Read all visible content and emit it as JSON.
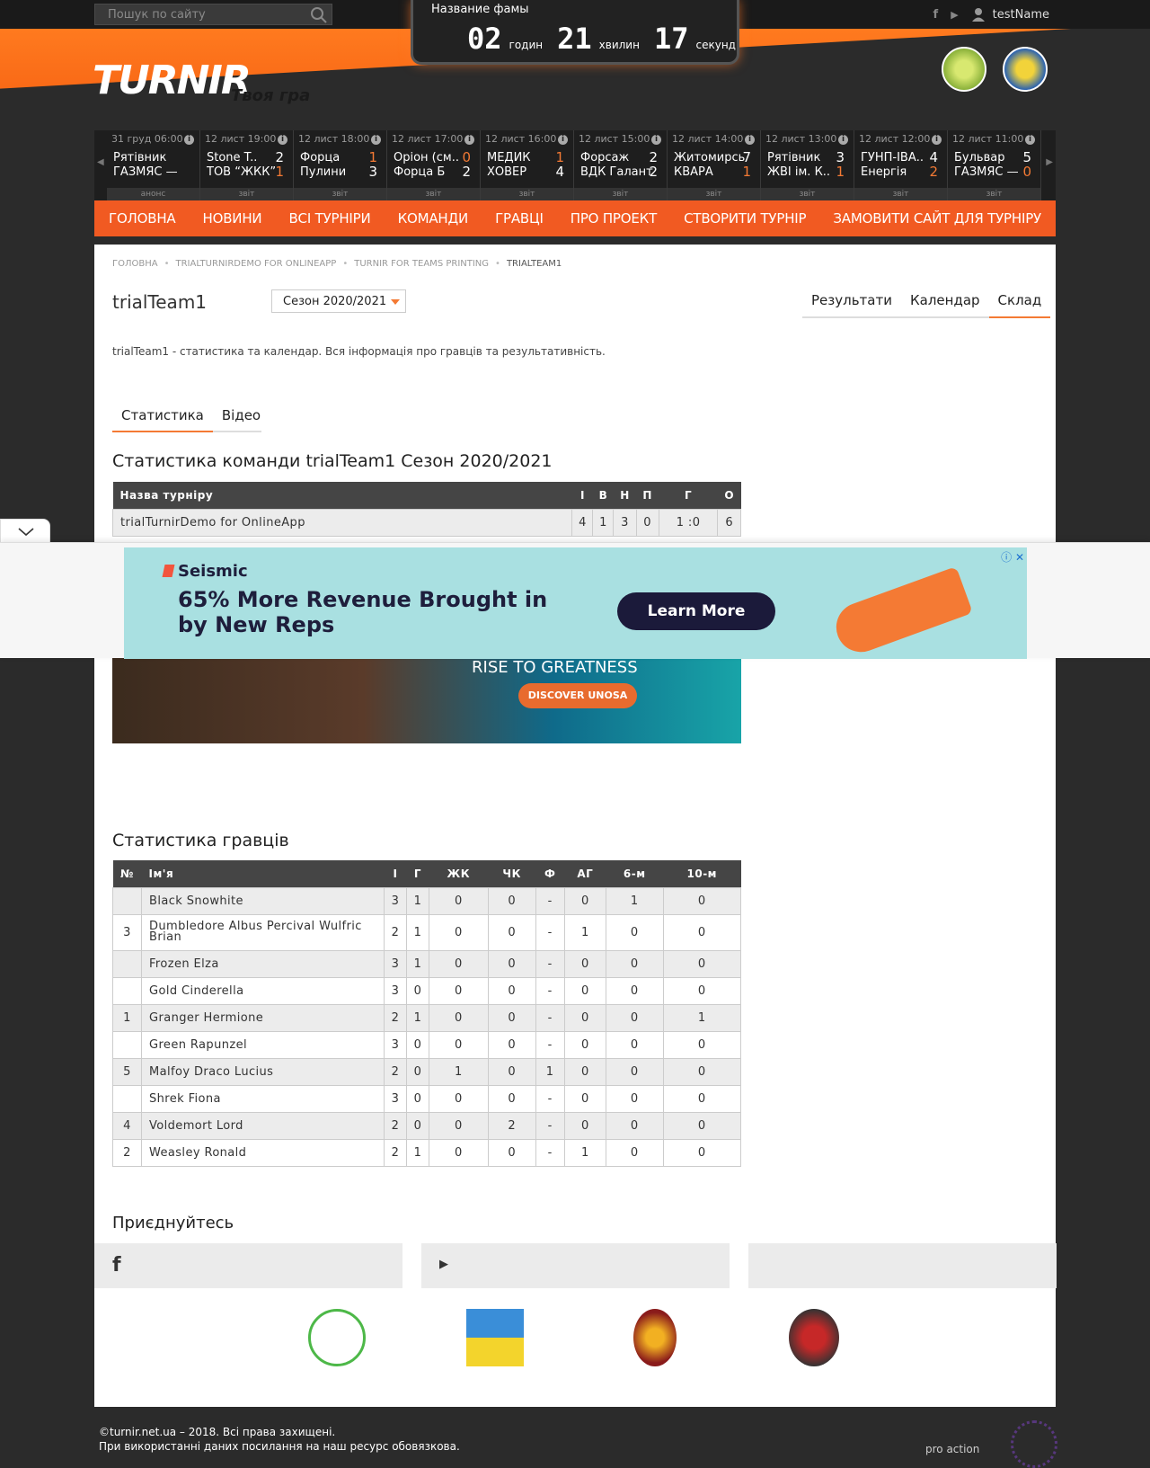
{
  "search": {
    "placeholder": "Пошук по сайту"
  },
  "user": {
    "name": "testName"
  },
  "logo": {
    "word": "TURNIR",
    "slogan": "Твоя гра"
  },
  "timer": {
    "title": "Название фамы",
    "hours": "02",
    "hours_label": "годин",
    "minutes": "21",
    "minutes_label": "хвилин",
    "seconds": "17",
    "seconds_label": "секунд"
  },
  "matches": [
    {
      "date": "31 груд 06:00",
      "team1": "Рятівник",
      "team2": "ГАЗМЯС —",
      "score1": "",
      "score2": "",
      "report": "анонс"
    },
    {
      "date": "12 лист 19:00",
      "team1": "Stone T..",
      "team2": "ТОВ “ЖКК”",
      "score1": "2",
      "score2": "1",
      "report": "звіт"
    },
    {
      "date": "12 лист 18:00",
      "team1": "Форца",
      "team2": "Пулини",
      "score1": "1",
      "score2": "3",
      "report": "звіт"
    },
    {
      "date": "12 лист 17:00",
      "team1": "Оріон (см..",
      "team2": "Форца Б",
      "score1": "0",
      "score2": "2",
      "report": "звіт"
    },
    {
      "date": "12 лист 16:00",
      "team1": "МЕДИК",
      "team2": "ХОВЕР",
      "score1": "1",
      "score2": "4",
      "report": "звіт"
    },
    {
      "date": "12 лист 15:00",
      "team1": "Форсаж",
      "team2": "ВДК Галант",
      "score1": "2",
      "score2": "2",
      "report": "звіт"
    },
    {
      "date": "12 лист 14:00",
      "team1": "Житомирсь",
      "team2": "КВАРА",
      "score1": "7",
      "score2": "1",
      "report": "звіт"
    },
    {
      "date": "12 лист 13:00",
      "team1": "Рятівник",
      "team2": "ЖВІ ім. К..",
      "score1": "3",
      "score2": "1",
      "report": "звіт"
    },
    {
      "date": "12 лист 12:00",
      "team1": "ГУНП-ІВА..",
      "team2": "Енергія",
      "score1": "4",
      "score2": "2",
      "report": "звіт"
    },
    {
      "date": "12 лист 11:00",
      "team1": "Бульвар",
      "team2": "ГАЗМЯС —",
      "score1": "5",
      "score2": "0",
      "report": "звіт"
    }
  ],
  "nav": [
    "ГОЛОВНА",
    "НОВИНИ",
    "ВСІ ТУРНІРИ",
    "КОМАНДИ",
    "ГРАВЦІ",
    "ПРО ПРОЕКТ",
    "СТВОРИТИ ТУРНІР",
    "ЗАМОВИТИ САЙТ ДЛЯ ТУРНІРУ"
  ],
  "breadcrumbs": [
    "ГОЛОВНА",
    "TRIALTURNIRDEMO FOR ONLINEAPP",
    "TURNIR FOR TEAMS PRINTING",
    "TRIALTEAM1"
  ],
  "page": {
    "title": "trialTeam1",
    "season": "Сезон 2020/2021",
    "tabs": [
      "Результати",
      "Календар",
      "Склад"
    ],
    "description": "trialTeam1 - статистика та календар. Вся інформація про гравців та результативність.",
    "subtabs": [
      "Статистика",
      "Відео"
    ]
  },
  "team_stats": {
    "title": "Статистика команди trialTeam1 Сезон 2020/2021",
    "headers": [
      "Назва турніру",
      "І",
      "В",
      "Н",
      "П",
      "Г",
      "О"
    ],
    "rows": [
      [
        "trialTurnirDemo for OnlineApp",
        "4",
        "1",
        "3",
        "0",
        "1 :0",
        "6"
      ]
    ]
  },
  "inline_ad": {
    "text": "RISE TO GREATNESS",
    "button": "DISCOVER UNOSA"
  },
  "player_stats": {
    "title": "Статистика гравців",
    "headers": [
      "№",
      "Ім'я",
      "І",
      "Г",
      "ЖК",
      "ЧК",
      "Ф",
      "АГ",
      "6-м",
      "10-м"
    ],
    "rows": [
      [
        "",
        "Black Snowhite",
        "3",
        "1",
        "0",
        "0",
        "-",
        "0",
        "1",
        "0"
      ],
      [
        "3",
        "Dumbledore Albus Percival Wulfric Brian",
        "2",
        "1",
        "0",
        "0",
        "-",
        "1",
        "0",
        "0"
      ],
      [
        "",
        "Frozen Elza",
        "3",
        "1",
        "0",
        "0",
        "-",
        "0",
        "0",
        "0"
      ],
      [
        "",
        "Gold Cinderella",
        "3",
        "0",
        "0",
        "0",
        "-",
        "0",
        "0",
        "0"
      ],
      [
        "1",
        "Granger Hermione",
        "2",
        "1",
        "0",
        "0",
        "-",
        "0",
        "0",
        "1"
      ],
      [
        "",
        "Green Rapunzel",
        "3",
        "0",
        "0",
        "0",
        "-",
        "0",
        "0",
        "0"
      ],
      [
        "5",
        "Malfoy Draco Lucius",
        "2",
        "0",
        "1",
        "0",
        "1",
        "0",
        "0",
        "0"
      ],
      [
        "",
        "Shrek Fiona",
        "3",
        "0",
        "0",
        "0",
        "-",
        "0",
        "0",
        "0"
      ],
      [
        "4",
        "Voldemort Lord",
        "2",
        "0",
        "0",
        "2",
        "-",
        "0",
        "0",
        "0"
      ],
      [
        "2",
        "Weasley Ronald",
        "2",
        "1",
        "0",
        "0",
        "-",
        "1",
        "0",
        "0"
      ]
    ]
  },
  "join": {
    "title": "Приєднуйтесь"
  },
  "overlay_ad": {
    "brand": "Seismic",
    "headline": "65% More Revenue Brought in by New Reps",
    "cta": "Learn More"
  },
  "footer": {
    "line1": "©turnir.net.ua – 2018. Всі права захищені.",
    "line2": "При використанні даних посилання на наш ресурс обовязкова.",
    "brand": "pro action"
  },
  "colors": {
    "accent": "#f15a22",
    "orange": "#f47a34",
    "dark": "#2b2b2b"
  }
}
